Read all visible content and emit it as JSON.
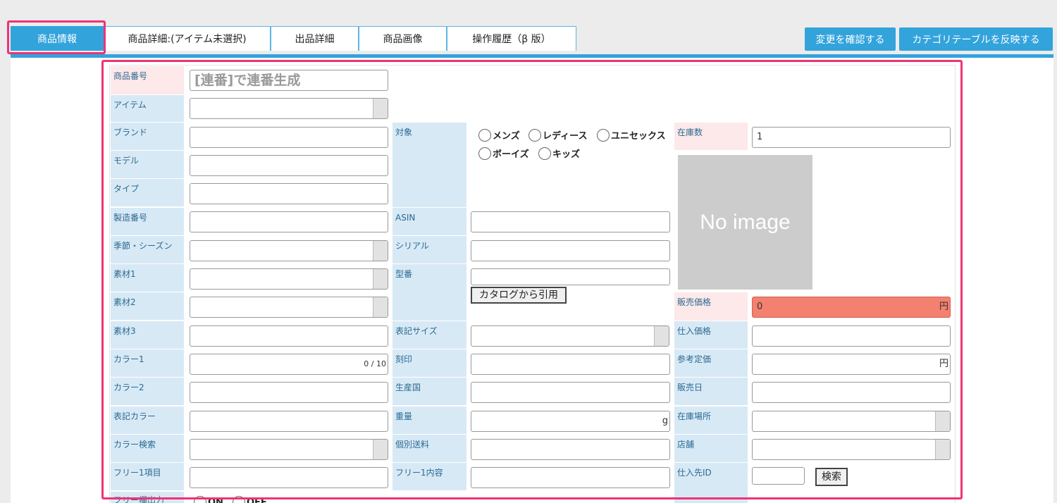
{
  "tabs": [
    "商品情報",
    "商品詳細:(アイテム未選択)",
    "出品詳細",
    "商品画像",
    "操作履歴（β 版）"
  ],
  "actions": {
    "confirm": "変更を確認する",
    "apply_category": "カテゴリテーブルを反映する"
  },
  "labels": {
    "product_number": "商品番号",
    "item": "アイテム",
    "brand": "ブランド",
    "model": "モデル",
    "type": "タイプ",
    "serial_mfg": "製造番号",
    "season": "季節・シーズン",
    "material1": "素材1",
    "material2": "素材2",
    "material3": "素材3",
    "color1": "カラー1",
    "color2": "カラー2",
    "display_color": "表記カラー",
    "color_search": "カラー検索",
    "free1_item": "フリー1項目",
    "free_output": "フリー欄出力",
    "target": "対象",
    "asin": "ASIN",
    "serial": "シリアル",
    "model_number": "型番",
    "display_size": "表記サイズ",
    "engraving": "刻印",
    "origin": "生産国",
    "weight": "重量",
    "shipping": "個別送料",
    "free1_content": "フリー1内容",
    "stock": "在庫数",
    "sale_price": "販売価格",
    "purchase_price": "仕入価格",
    "reference_price": "参考定価",
    "sale_date": "販売日",
    "stock_location": "在庫場所",
    "store": "店舗",
    "supplier_id": "仕入先ID"
  },
  "fields": {
    "product_number_placeholder": "[連番]で連番生成",
    "color1_counter": "0 / 10",
    "stock_value": "1",
    "sale_price_value": "0",
    "yen": "円",
    "gram": "g"
  },
  "target_options": [
    "メンズ",
    "レディース",
    "ユニセックス",
    "ボーイズ",
    "キッズ"
  ],
  "free_output_options": [
    "ON",
    "OFF"
  ],
  "buttons": {
    "catalog": "カタログから引用",
    "search": "検索"
  },
  "image_placeholder": "No image"
}
